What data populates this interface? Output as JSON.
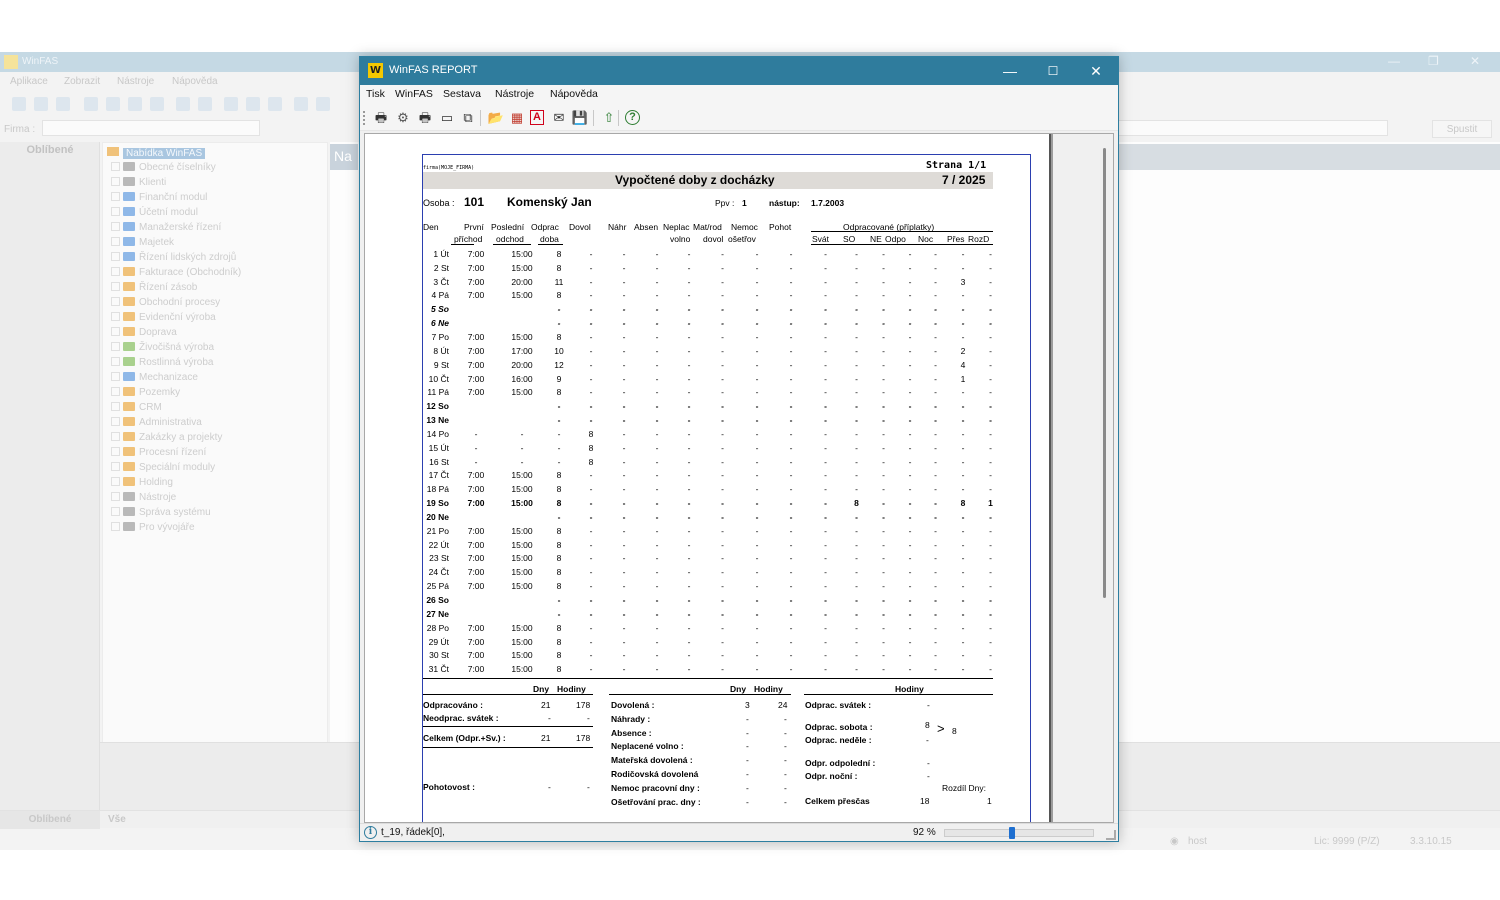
{
  "background_window": {
    "title": "WinFAS",
    "menu": [
      "Aplikace",
      "Zobrazit",
      "Nástroje",
      "Nápověda"
    ],
    "firma_label": "Firma :",
    "favorites_header": "Oblíbené",
    "tree_root": "Nabídka WinFAS",
    "tree_items": [
      {
        "label": "Obecné číselníky",
        "color": "#b9b9b9"
      },
      {
        "label": "Klienti",
        "color": "#b9b9b9"
      },
      {
        "label": "Finanční modul",
        "color": "#8fb8e8"
      },
      {
        "label": "Účetní modul",
        "color": "#8fb8e8"
      },
      {
        "label": "Manažerské řízení",
        "color": "#8fb8e8"
      },
      {
        "label": "Majetek",
        "color": "#8fb8e8"
      },
      {
        "label": "Řízení lidských zdrojů",
        "color": "#8fb8e8"
      },
      {
        "label": "Fakturace (Obchodník)",
        "color": "#f0c27a"
      },
      {
        "label": "Řízení zásob",
        "color": "#f0c27a"
      },
      {
        "label": "Obchodní procesy",
        "color": "#f0c27a"
      },
      {
        "label": "Evidenční výroba",
        "color": "#f0c27a"
      },
      {
        "label": "Doprava",
        "color": "#f0c27a"
      },
      {
        "label": "Živočišná výroba",
        "color": "#a9d18e"
      },
      {
        "label": "Rostlinná výroba",
        "color": "#a9d18e"
      },
      {
        "label": "Mechanizace",
        "color": "#8fb8e8"
      },
      {
        "label": "Pozemky",
        "color": "#f0c27a"
      },
      {
        "label": "CRM",
        "color": "#f0c27a"
      },
      {
        "label": "Administrativa",
        "color": "#f0c27a"
      },
      {
        "label": "Zakázky a projekty",
        "color": "#f0c27a"
      },
      {
        "label": "Procesní řízení",
        "color": "#f0c27a"
      },
      {
        "label": "Speciální moduly",
        "color": "#f0c27a"
      },
      {
        "label": "Holding",
        "color": "#f0c27a"
      },
      {
        "label": "Nástroje",
        "color": "#b9b9b9"
      },
      {
        "label": "Správa systému",
        "color": "#b9b9b9"
      },
      {
        "label": "Pro vývojáře",
        "color": "#b9b9b9"
      }
    ],
    "right_tab": "Na",
    "spust_label": "Spustit",
    "bottom_tabs": [
      "Oblíbené",
      "Vše"
    ],
    "status_user": "host",
    "status_lic": "Lic: 9999 (P/Z)",
    "status_version": "3.3.10.15"
  },
  "report_window": {
    "logo_text": "W",
    "title": "WinFAS REPORT",
    "controls": {
      "minimize": "—",
      "maximize": "☐",
      "close": "✕"
    },
    "menu": [
      "Tisk",
      "WinFAS",
      "Sestava",
      "Nástroje",
      "Nápověda"
    ],
    "toolbar": [
      {
        "name": "print-icon",
        "glyph": "🖶",
        "color": "#333333"
      },
      {
        "name": "settings-icon",
        "glyph": "⚙",
        "color": "#555555"
      },
      {
        "name": "printer-setup-icon",
        "glyph": "🖶",
        "color": "#333333"
      },
      {
        "name": "page-setup-icon",
        "glyph": "▭",
        "color": "#333333"
      },
      {
        "name": "copy-icon",
        "glyph": "⧉",
        "color": "#333333"
      },
      {
        "name": "export-folder-icon",
        "glyph": "📂",
        "color": "#c58a00"
      },
      {
        "name": "spreadsheet-icon",
        "glyph": "▦",
        "color": "#c0392b"
      },
      {
        "name": "pdf-icon",
        "glyph": "A",
        "color": "#d0021b"
      },
      {
        "name": "email-icon",
        "glyph": "✉",
        "color": "#333333"
      },
      {
        "name": "save-icon",
        "glyph": "💾",
        "color": "#1e6fd0"
      },
      {
        "name": "upload-icon",
        "glyph": "⇧",
        "color": "#2e7d32"
      },
      {
        "name": "help-icon",
        "glyph": "?",
        "color": "#2e7d32"
      }
    ],
    "status": {
      "message": "t_19, řádek[0],",
      "zoom": "92 %",
      "zoom_value": 0.45
    }
  },
  "report": {
    "firma_tag": "firma(MOJE_FIRMA)",
    "page": "Strana 1/1",
    "title": "Vypočtené doby z docházky",
    "period": "7 / 2025",
    "osoba_label": "Osoba :",
    "osoba_number": "101",
    "osoba_name": "Komenský Jan",
    "ppv_label": "Ppv :",
    "ppv_value": "1",
    "nastup_label": "nástup:",
    "nastup_value": "1.7.2003",
    "header_top": [
      "Den",
      "První",
      "Poslední",
      "Odprac",
      "Dovol",
      "Náhr",
      "Absen",
      "Neplac",
      "Mat/rod",
      "Nemoc",
      "Pohot"
    ],
    "header_bottom": [
      "příchod",
      "odchod",
      "doba",
      "volno",
      "dovol",
      "ošetřov"
    ],
    "group_label": "Odpracované (příplatky)",
    "group_columns": [
      "Svát",
      "SO",
      "NE",
      "Odpo",
      "Noc",
      "Přes",
      "RozD"
    ],
    "days": [
      {
        "day": "1 Út",
        "a": "7:00",
        "o": "15:00",
        "d": "8",
        "v": "-",
        "sel": "",
        "so": "-",
        "pr": "-",
        "rd": "-"
      },
      {
        "day": "2 St",
        "a": "7:00",
        "o": "15:00",
        "d": "8",
        "v": "-",
        "sel": "",
        "so": "-",
        "pr": "-",
        "rd": "-"
      },
      {
        "day": "3 Čt",
        "a": "7:00",
        "o": "20:00",
        "d": "11",
        "v": "-",
        "sel": "",
        "so": "-",
        "pr": "3",
        "rd": "-"
      },
      {
        "day": "4 Pá",
        "a": "7:00",
        "o": "15:00",
        "d": "8",
        "v": "-",
        "sel": "",
        "so": "-",
        "pr": "-",
        "rd": "-"
      },
      {
        "day": "5 So",
        "a": "",
        "o": "",
        "d": "-",
        "v": "-",
        "sel": "we",
        "so": "-",
        "pr": "-",
        "rd": "-"
      },
      {
        "day": "6 Ne",
        "a": "",
        "o": "",
        "d": "-",
        "v": "-",
        "sel": "we",
        "so": "-",
        "pr": "-",
        "rd": "-"
      },
      {
        "day": "7 Po",
        "a": "7:00",
        "o": "15:00",
        "d": "8",
        "v": "-",
        "sel": "",
        "so": "-",
        "pr": "-",
        "rd": "-"
      },
      {
        "day": "8 Út",
        "a": "7:00",
        "o": "17:00",
        "d": "10",
        "v": "-",
        "sel": "",
        "so": "-",
        "pr": "2",
        "rd": "-"
      },
      {
        "day": "9 St",
        "a": "7:00",
        "o": "20:00",
        "d": "12",
        "v": "-",
        "sel": "",
        "so": "-",
        "pr": "4",
        "rd": "-"
      },
      {
        "day": "10 Čt",
        "a": "7:00",
        "o": "16:00",
        "d": "9",
        "v": "-",
        "sel": "",
        "so": "-",
        "pr": "1",
        "rd": "-"
      },
      {
        "day": "11 Pá",
        "a": "7:00",
        "o": "15:00",
        "d": "8",
        "v": "-",
        "sel": "",
        "so": "-",
        "pr": "-",
        "rd": "-"
      },
      {
        "day": "12 So",
        "a": "",
        "o": "",
        "d": "-",
        "v": "-",
        "sel": "bd",
        "so": "-",
        "pr": "-",
        "rd": "-"
      },
      {
        "day": "13 Ne",
        "a": "",
        "o": "",
        "d": "-",
        "v": "-",
        "sel": "bd",
        "so": "-",
        "pr": "-",
        "rd": "-"
      },
      {
        "day": "14 Po",
        "a": "-",
        "o": "-",
        "d": "-",
        "v": "8",
        "sel": "",
        "so": "-",
        "pr": "-",
        "rd": "-"
      },
      {
        "day": "15 Út",
        "a": "-",
        "o": "-",
        "d": "-",
        "v": "8",
        "sel": "",
        "so": "-",
        "pr": "-",
        "rd": "-"
      },
      {
        "day": "16 St",
        "a": "-",
        "o": "-",
        "d": "-",
        "v": "8",
        "sel": "",
        "so": "-",
        "pr": "-",
        "rd": "-"
      },
      {
        "day": "17 Čt",
        "a": "7:00",
        "o": "15:00",
        "d": "8",
        "v": "-",
        "sel": "",
        "so": "-",
        "pr": "-",
        "rd": "-"
      },
      {
        "day": "18 Pá",
        "a": "7:00",
        "o": "15:00",
        "d": "8",
        "v": "-",
        "sel": "",
        "so": "-",
        "pr": "-",
        "rd": "-"
      },
      {
        "day": "19 So",
        "a": "7:00",
        "o": "15:00",
        "d": "8",
        "v": "-",
        "sel": "bd",
        "so": "8",
        "pr": "8",
        "rd": "1"
      },
      {
        "day": "20 Ne",
        "a": "",
        "o": "",
        "d": "-",
        "v": "-",
        "sel": "bd",
        "so": "-",
        "pr": "-",
        "rd": "-"
      },
      {
        "day": "21 Po",
        "a": "7:00",
        "o": "15:00",
        "d": "8",
        "v": "-",
        "sel": "",
        "so": "-",
        "pr": "-",
        "rd": "-"
      },
      {
        "day": "22 Út",
        "a": "7:00",
        "o": "15:00",
        "d": "8",
        "v": "-",
        "sel": "",
        "so": "-",
        "pr": "-",
        "rd": "-"
      },
      {
        "day": "23 St",
        "a": "7:00",
        "o": "15:00",
        "d": "8",
        "v": "-",
        "sel": "",
        "so": "-",
        "pr": "-",
        "rd": "-"
      },
      {
        "day": "24 Čt",
        "a": "7:00",
        "o": "15:00",
        "d": "8",
        "v": "-",
        "sel": "",
        "so": "-",
        "pr": "-",
        "rd": "-"
      },
      {
        "day": "25 Pá",
        "a": "7:00",
        "o": "15:00",
        "d": "8",
        "v": "-",
        "sel": "",
        "so": "-",
        "pr": "-",
        "rd": "-"
      },
      {
        "day": "26 So",
        "a": "",
        "o": "",
        "d": "-",
        "v": "-",
        "sel": "bd",
        "so": "-",
        "pr": "-",
        "rd": "-"
      },
      {
        "day": "27 Ne",
        "a": "",
        "o": "",
        "d": "-",
        "v": "-",
        "sel": "bd",
        "so": "-",
        "pr": "-",
        "rd": "-"
      },
      {
        "day": "28 Po",
        "a": "7:00",
        "o": "15:00",
        "d": "8",
        "v": "-",
        "sel": "",
        "so": "-",
        "pr": "-",
        "rd": "-"
      },
      {
        "day": "29 Út",
        "a": "7:00",
        "o": "15:00",
        "d": "8",
        "v": "-",
        "sel": "",
        "so": "-",
        "pr": "-",
        "rd": "-"
      },
      {
        "day": "30 St",
        "a": "7:00",
        "o": "15:00",
        "d": "8",
        "v": "-",
        "sel": "",
        "so": "-",
        "pr": "-",
        "rd": "-"
      },
      {
        "day": "31 Čt",
        "a": "7:00",
        "o": "15:00",
        "d": "8",
        "v": "-",
        "sel": "",
        "so": "-",
        "pr": "-",
        "rd": "-"
      }
    ],
    "dash": "-",
    "summary": {
      "dny": "Dny",
      "hodiny": "Hodiny",
      "odpracovano": {
        "label": "Odpracováno :",
        "dny": "21",
        "hodiny": "178"
      },
      "neodprac_svatek": {
        "label": "Neodprac. svátek :",
        "dny": "-",
        "hodiny": "-"
      },
      "celkem": {
        "label": "Celkem (Odpr.+Sv.) :",
        "dny": "21",
        "hodiny": "178"
      },
      "pohotovost": {
        "label": "Pohotovost :",
        "dny": "-",
        "hodiny": "-"
      },
      "dovolena": {
        "label": "Dovolená :",
        "dny": "3",
        "hodiny": "24"
      },
      "nahrady": {
        "label": "Náhrady :",
        "dny": "-",
        "hodiny": "-"
      },
      "absence": {
        "label": "Absence :",
        "dny": "-",
        "hodiny": "-"
      },
      "neplacene": {
        "label": "Neplacené volno :",
        "dny": "-",
        "hodiny": "-"
      },
      "materska": {
        "label": "Mateřská dovolená :",
        "dny": "-",
        "hodiny": "-"
      },
      "rodicovska": {
        "label": "Rodičovská dovolená",
        "dny": "-",
        "hodiny": "-"
      },
      "nemoc": {
        "label": "Nemoc pracovní dny :",
        "dny": "-",
        "hodiny": "-"
      },
      "osetrovani": {
        "label": "Ošetřování prac. dny :",
        "dny": "-",
        "hodiny": "-"
      },
      "odprac_svatek": {
        "label": "Odprac. svátek :",
        "hodiny": "-"
      },
      "odprac_sobota": {
        "label": "Odprac. sobota :",
        "hodiny": "8"
      },
      "odprac_nedele": {
        "label": "Odprac. neděle :",
        "hodiny": "-"
      },
      "gt": ">",
      "weekend_total": "8",
      "odpoledni": {
        "label": "Odpr. odpolední :",
        "hodiny": "-"
      },
      "nocni": {
        "label": "Odpr. noční :",
        "hodiny": "-"
      },
      "rozdil_label": "Rozdíl Dny:",
      "celkem_prescas": {
        "label": "Celkem přesčas",
        "hodiny": "18",
        "rozdil": "1"
      }
    }
  }
}
